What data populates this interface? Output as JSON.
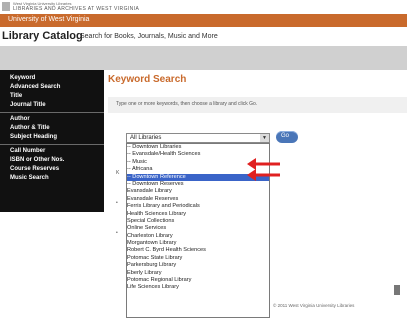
{
  "header": {
    "logo_line1": "West Virginia University Libraries",
    "logo_line2": "LIBRARIES AND ARCHIVES AT WEST VIRGINIA",
    "orange_bar_text": "University of West Virginia"
  },
  "page": {
    "title": "Library Catalog",
    "subtitle": "Search for Books, Journals, Music and More"
  },
  "sidebar": {
    "groups": [
      [
        "Keyword",
        "Advanced Search",
        "Title",
        "Journal Title"
      ],
      [
        "Author",
        "Author & Title",
        "Subject Heading"
      ],
      [
        "Call Number",
        "ISBN or Other Nos.",
        "Course Reserves",
        "Music Search"
      ]
    ]
  },
  "main": {
    "heading": "Keyword Search",
    "hint": "Type one or more keywords, then choose a library and click Go.",
    "select_value": "All Libraries",
    "go_label": "Go",
    "dropdown": {
      "selected_index": 4,
      "options": [
        "-- Downtown Libraries",
        "-- Evansdale/Health Sciences",
        "-- Music",
        "-- Africana",
        "-- Downtown Reference",
        "-- Downtown Reserves",
        "Evansdale Library",
        "Evansdale Reserves",
        "Ferris Library and Periodicals",
        "Health Sciences Library",
        "Special Collections",
        "Online Services",
        "Charleston Library",
        "Morgantown Library",
        "Robert C. Byrd Health Sciences",
        "Potomac State Library",
        "Parkersburg Library",
        "Eberly Library",
        "Potomac Regional Library",
        "Life Sciences Library"
      ]
    },
    "footer_text": "© 2011 West Virginia University Libraries"
  },
  "colors": {
    "orange": "#c96a2c",
    "sidebar_bg": "#111111",
    "highlight": "#3a64c8",
    "arrow_red": "#e02020"
  }
}
